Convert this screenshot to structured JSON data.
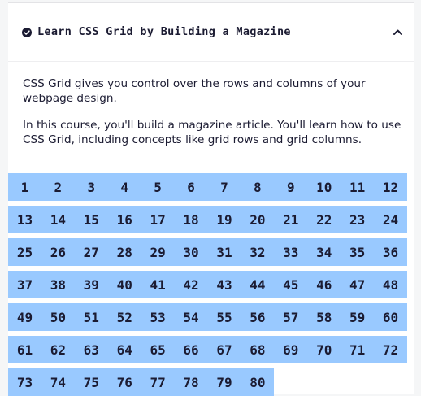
{
  "header": {
    "title": "Learn CSS Grid by Building a Magazine",
    "status_icon": "check-circle-icon",
    "toggle_icon": "chevron-up-icon"
  },
  "description": [
    "CSS Grid gives you control over the rows and columns of your webpage design.",
    "In this course, you'll build a magazine article. You'll learn how to use CSS Grid, including concepts like grid rows and grid columns."
  ],
  "steps": [
    "1",
    "2",
    "3",
    "4",
    "5",
    "6",
    "7",
    "8",
    "9",
    "10",
    "11",
    "12",
    "13",
    "14",
    "15",
    "16",
    "17",
    "18",
    "19",
    "20",
    "21",
    "22",
    "23",
    "24",
    "25",
    "26",
    "27",
    "28",
    "29",
    "30",
    "31",
    "32",
    "33",
    "34",
    "35",
    "36",
    "37",
    "38",
    "39",
    "40",
    "41",
    "42",
    "43",
    "44",
    "45",
    "46",
    "47",
    "48",
    "49",
    "50",
    "51",
    "52",
    "53",
    "54",
    "55",
    "56",
    "57",
    "58",
    "59",
    "60",
    "61",
    "62",
    "63",
    "64",
    "65",
    "66",
    "67",
    "68",
    "69",
    "70",
    "71",
    "72",
    "73",
    "74",
    "75",
    "76",
    "77",
    "78",
    "79",
    "80"
  ],
  "colors": {
    "cell_bg": "#99c9ff",
    "text": "#1b1b32"
  }
}
